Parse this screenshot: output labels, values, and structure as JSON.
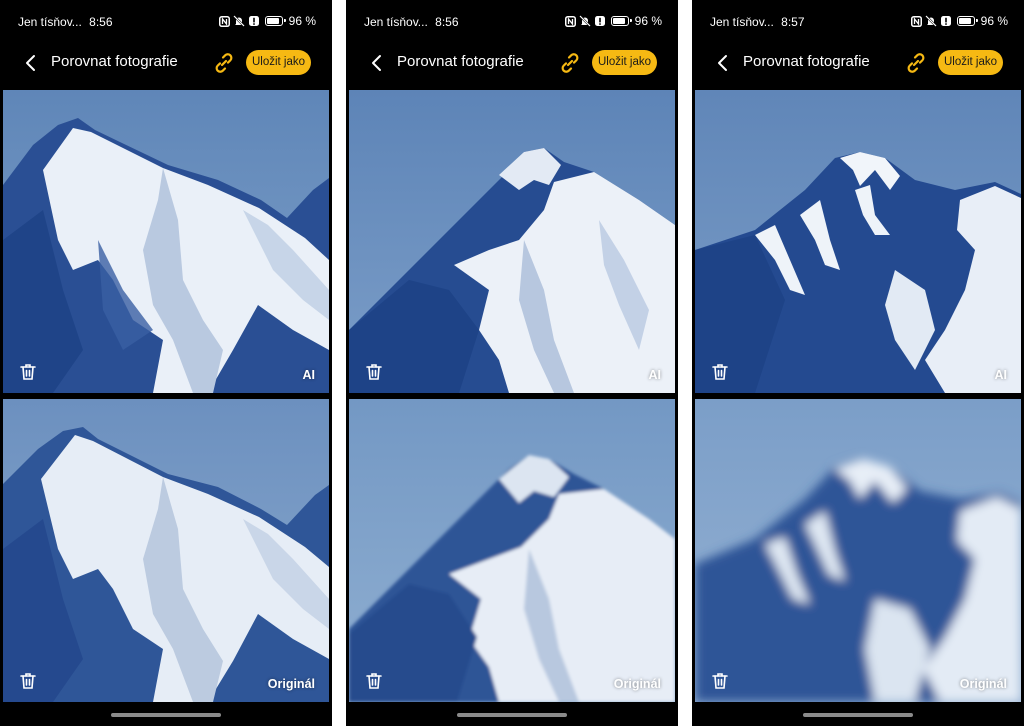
{
  "screens": [
    {
      "status": {
        "carrier": "Jen tísňov...",
        "time": "8:56",
        "battery": "96 %"
      },
      "app_bar": {
        "title": "Porovnat fotografie",
        "save_label": "Uložit jako"
      },
      "panels": [
        {
          "label": "AI"
        },
        {
          "label": "Originál"
        }
      ]
    },
    {
      "status": {
        "carrier": "Jen tísňov...",
        "time": "8:56",
        "battery": "96 %"
      },
      "app_bar": {
        "title": "Porovnat fotografie",
        "save_label": "Uložit jako"
      },
      "panels": [
        {
          "label": "AI"
        },
        {
          "label": "Originál"
        }
      ]
    },
    {
      "status": {
        "carrier": "Jen tísňov...",
        "time": "8:57",
        "battery": "96 %"
      },
      "app_bar": {
        "title": "Porovnat fotografie",
        "save_label": "Uložit jako"
      },
      "panels": [
        {
          "label": "AI"
        },
        {
          "label": "Originál"
        }
      ]
    }
  ],
  "colors": {
    "accent": "#f6b913",
    "sky": "#6f93be",
    "mountain_shadow": "#25498e",
    "snow": "#eef3f9"
  },
  "icons": {
    "status": [
      "nfc-icon",
      "mute-icon",
      "alert-icon",
      "battery-icon"
    ],
    "app_bar": [
      "back-arrow-icon",
      "link-icon"
    ],
    "panel": [
      "trash-icon"
    ]
  }
}
